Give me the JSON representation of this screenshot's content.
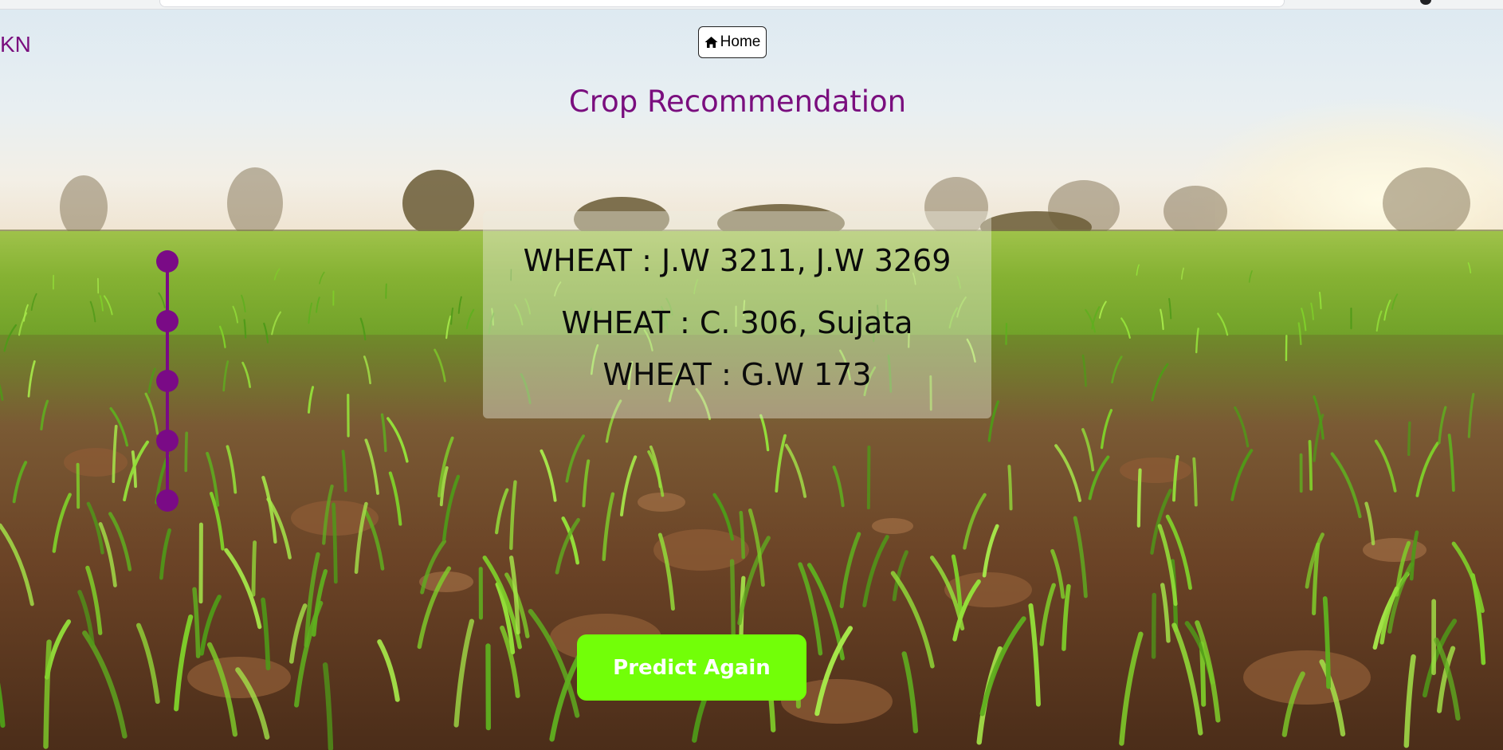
{
  "brand": {
    "text": "KN"
  },
  "nav": {
    "home_label": "Home",
    "home_icon": "home-icon"
  },
  "page": {
    "title": "Crop Recommendation"
  },
  "results": [
    "WHEAT : J.W 3211, J.W 3269",
    "WHEAT : C. 306, Sujata",
    "WHEAT : G.W 173"
  ],
  "stepper": {
    "dot_count": 5
  },
  "actions": {
    "predict_again_label": "Predict Again"
  },
  "colors": {
    "accent_purple": "#7a0e7e",
    "button_green": "#72ff08",
    "button_text": "#ffffff"
  }
}
